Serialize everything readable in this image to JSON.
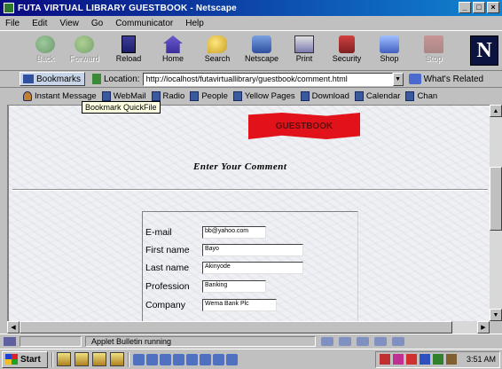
{
  "window": {
    "title": "FUTA VIRTUAL LIBRARY GUESTBOOK - Netscape",
    "controls": [
      "_",
      "□",
      "×"
    ]
  },
  "menu": [
    "File",
    "Edit",
    "View",
    "Go",
    "Communicator",
    "Help"
  ],
  "toolbar": {
    "back": "Back",
    "forward": "Forward",
    "reload": "Reload",
    "home": "Home",
    "search": "Search",
    "netscape": "Netscape",
    "print": "Print",
    "security": "Security",
    "shop": "Shop",
    "stop": "Stop",
    "logo": "N"
  },
  "location": {
    "bookmarks": "Bookmarks",
    "label": "Location:",
    "url": "http://localhost/futavirtuallibrary/guestbook/comment.html",
    "related": "What's Related"
  },
  "personal": [
    "Instant Message",
    "WebMail",
    "Radio",
    "People",
    "Yellow Pages",
    "Download",
    "Calendar",
    "Chan"
  ],
  "tooltip": "Bookmark QuickFile",
  "page": {
    "banner": "GUESTBOOK",
    "heading": "Enter Your Comment",
    "fields": [
      {
        "label": "E-mail",
        "value": "bb@yahoo.com"
      },
      {
        "label": "First name",
        "value": "Bayo"
      },
      {
        "label": "Last name",
        "value": "Akinyode"
      },
      {
        "label": "Profession",
        "value": "Banking"
      },
      {
        "label": "Company",
        "value": "Wema Bank Plc"
      }
    ]
  },
  "status": {
    "text": "Applet Bulletin running"
  },
  "taskbar": {
    "start": "Start",
    "clock": "3:51 AM"
  }
}
